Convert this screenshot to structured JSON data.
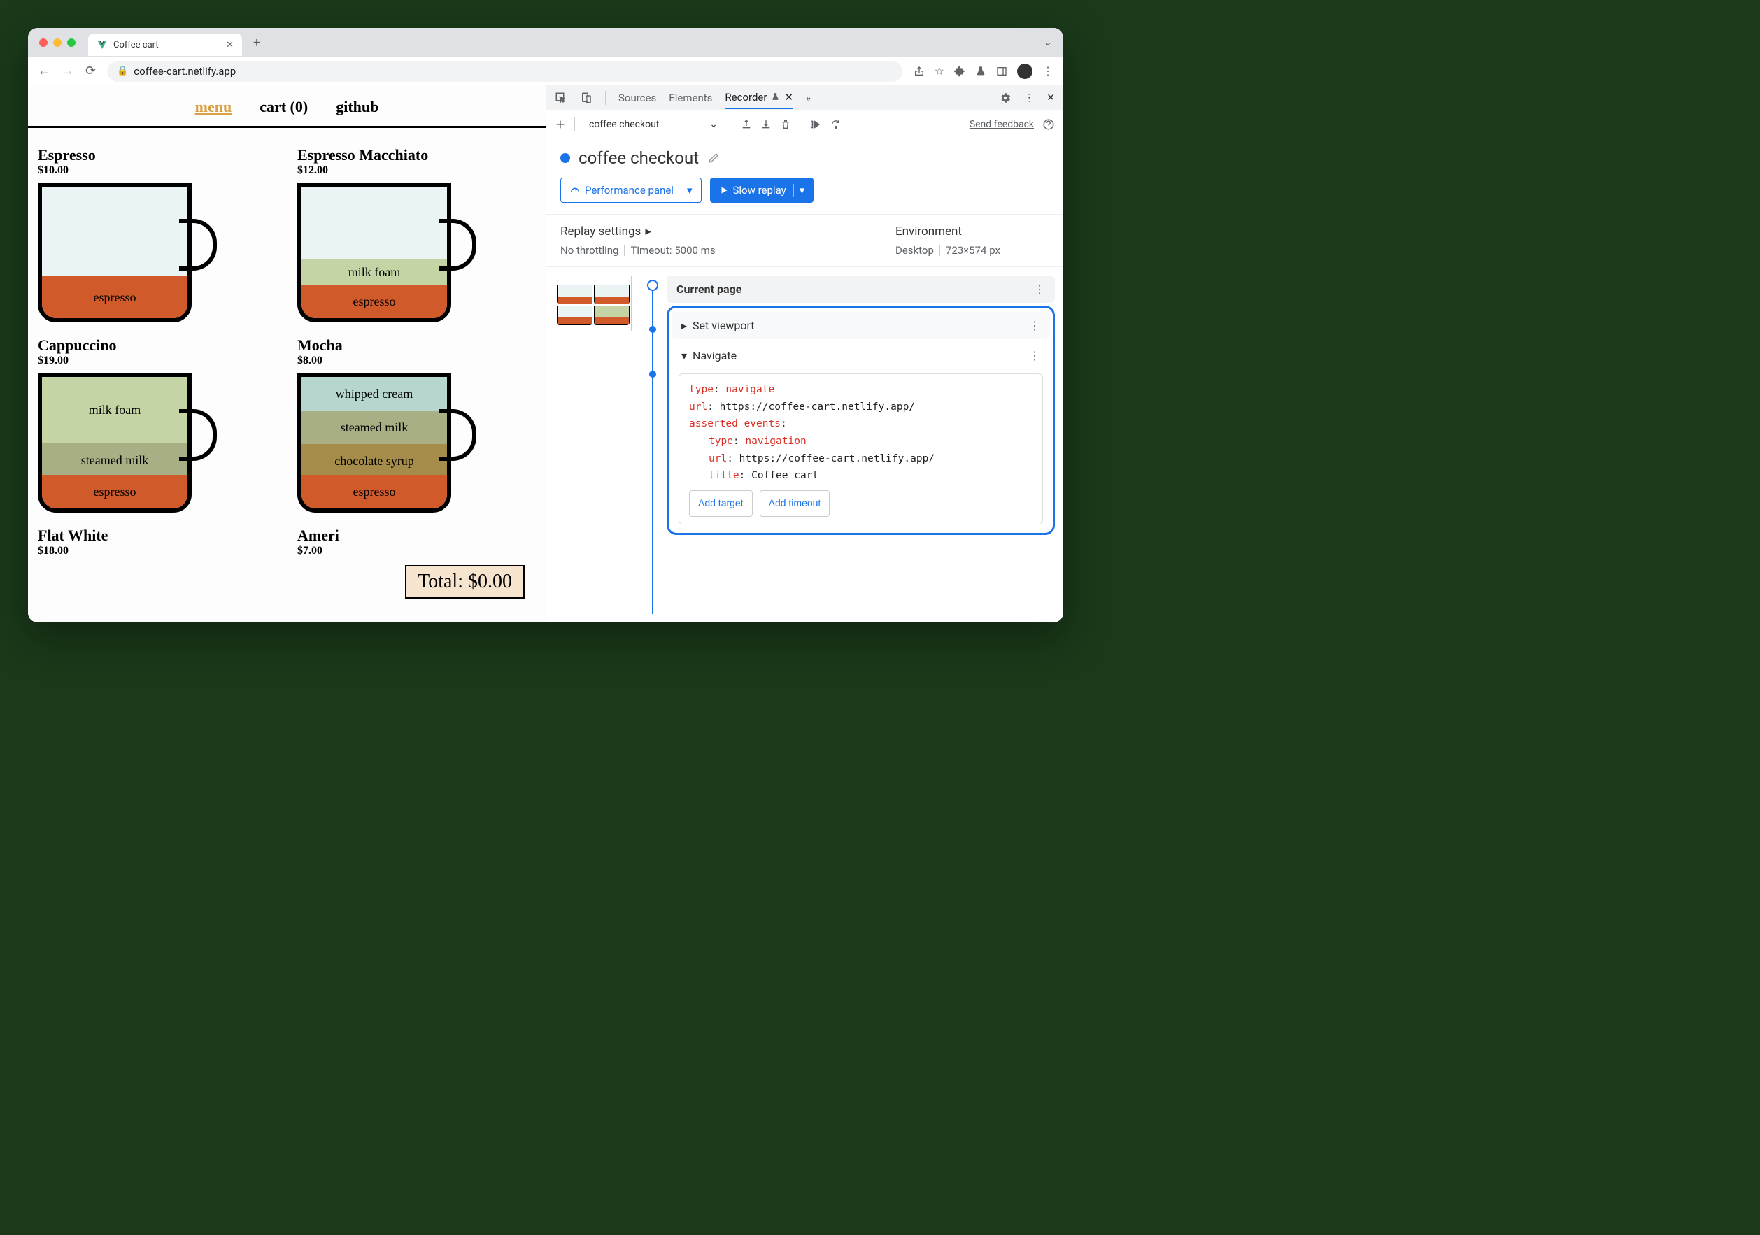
{
  "browser": {
    "tab_title": "Coffee cart",
    "url": "coffee-cart.netlify.app"
  },
  "page": {
    "nav": {
      "menu": "menu",
      "cart": "cart (0)",
      "github": "github"
    },
    "products": [
      {
        "name": "Espresso",
        "price": "$10.00"
      },
      {
        "name": "Espresso Macchiato",
        "price": "$12.00"
      },
      {
        "name": "Cappuccino",
        "price": "$19.00"
      },
      {
        "name": "Mocha",
        "price": "$8.00"
      },
      {
        "name": "Flat White",
        "price": "$18.00"
      },
      {
        "name": "Americano",
        "price": "$7.00"
      }
    ],
    "layers": {
      "espresso": "espresso",
      "milk_foam": "milk foam",
      "steamed_milk": "steamed milk",
      "chocolate_syrup": "chocolate syrup",
      "whipped_cream": "whipped cream"
    },
    "total": "Total: $0.00"
  },
  "devtools": {
    "tabs": {
      "sources": "Sources",
      "elements": "Elements",
      "recorder": "Recorder"
    },
    "toolbar": {
      "recording_name": "coffee checkout",
      "feedback": "Send feedback"
    },
    "recording_title": "coffee checkout",
    "buttons": {
      "perf": "Performance panel",
      "replay": "Slow replay"
    },
    "replay_settings": {
      "heading": "Replay settings",
      "throttling": "No throttling",
      "timeout": "Timeout: 5000 ms"
    },
    "environment": {
      "heading": "Environment",
      "device": "Desktop",
      "viewport": "723×574 px"
    },
    "steps": {
      "current_page": "Current page",
      "set_viewport": "Set viewport",
      "navigate": "Navigate",
      "detail": {
        "type_k": "type",
        "type_v": "navigate",
        "url_k": "url",
        "url_v": "https://coffee-cart.netlify.app/",
        "asserted_k": "asserted events",
        "nav_type_v": "navigation",
        "nav_url_v": "https://coffee-cart.netlify.app/",
        "title_k": "title",
        "title_v": "Coffee cart",
        "add_target": "Add target",
        "add_timeout": "Add timeout"
      }
    }
  }
}
